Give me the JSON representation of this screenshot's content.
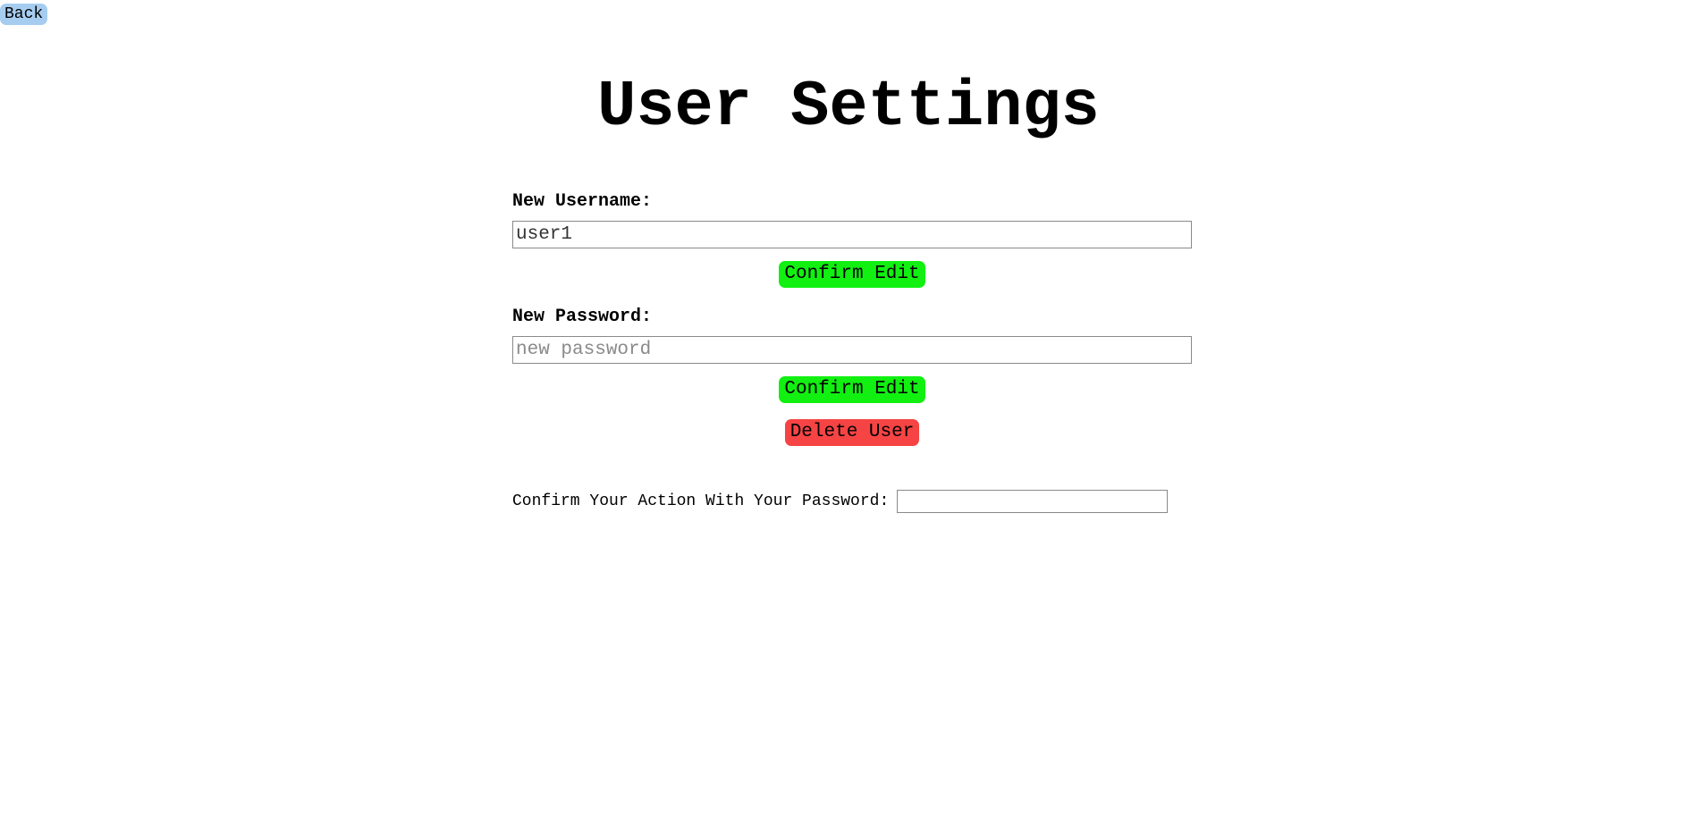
{
  "nav": {
    "back_label": "Back"
  },
  "page": {
    "title": "User Settings"
  },
  "username_section": {
    "label": "New Username:",
    "value": "user1",
    "placeholder": "",
    "confirm_label": "Confirm Edit"
  },
  "password_section": {
    "label": "New Password:",
    "value": "",
    "placeholder": "new password",
    "confirm_label": "Confirm Edit"
  },
  "delete": {
    "label": "Delete User"
  },
  "confirm_action": {
    "label": "Confirm Your Action With Your Password:",
    "value": ""
  },
  "colors": {
    "back_bg": "#a6cdf0",
    "confirm_bg": "#12f012",
    "delete_bg": "#f64444"
  }
}
